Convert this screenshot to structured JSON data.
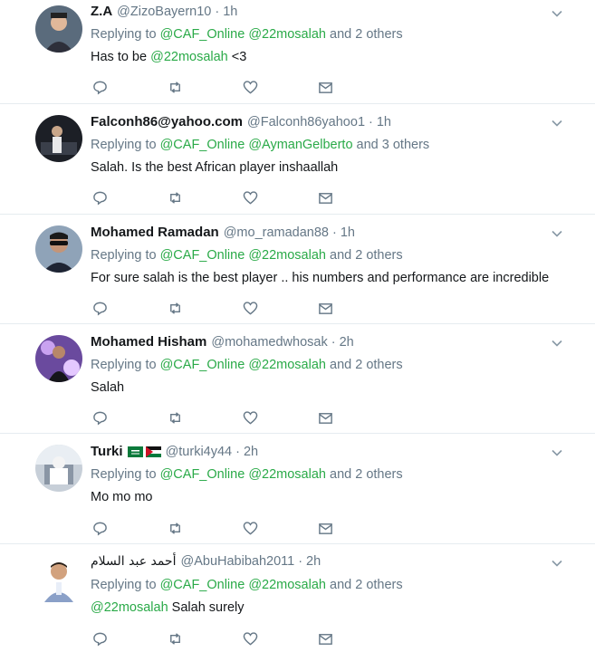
{
  "tweets": [
    {
      "name": "Z.A",
      "handle": "@ZizoBayern10",
      "time": "1h",
      "replying_to": "Replying to",
      "mention1": "@CAF_Online",
      "mention2": "@22mosalah",
      "others": "and 2 others",
      "text_prefix": "Has to be ",
      "text_mention": "@22mosalah",
      "text_suffix": " <3",
      "avatar_icon": "user-avatar"
    },
    {
      "name": "Falconh86@yahoo.com",
      "handle": "@Falconh86yahoo1",
      "time": "1h",
      "replying_to": "Replying to",
      "mention1": "@CAF_Online",
      "mention2": "@AymanGelberto",
      "others": "and 3 others",
      "text": "Salah. Is the best African player inshaallah",
      "avatar_icon": "user-avatar"
    },
    {
      "name": "Mohamed Ramadan",
      "handle": "@mo_ramadan88",
      "time": "1h",
      "replying_to": "Replying to",
      "mention1": "@CAF_Online",
      "mention2": "@22mosalah",
      "others": "and 2 others",
      "text": "For sure salah is the best player .. his numbers and performance are incredible",
      "avatar_icon": "user-avatar"
    },
    {
      "name": "Mohamed Hisham",
      "handle": "@mohamedwhosak",
      "time": "2h",
      "replying_to": "Replying to",
      "mention1": "@CAF_Online",
      "mention2": "@22mosalah",
      "others": "and 2 others",
      "text": "Salah",
      "avatar_icon": "user-avatar"
    },
    {
      "name": "Turki",
      "handle": "@turki4y44",
      "time": "2h",
      "replying_to": "Replying to",
      "mention1": "@CAF_Online",
      "mention2": "@22mosalah",
      "others": "and 2 others",
      "text": "Mo mo mo",
      "flags": [
        "saudi-flag-icon",
        "jordan-flag-icon"
      ],
      "avatar_icon": "user-avatar"
    },
    {
      "name": "أحمد عبد السلام",
      "handle": "@AbuHabibah2011",
      "time": "2h",
      "replying_to": "Replying to",
      "mention1": "@CAF_Online",
      "mention2": "@22mosalah",
      "others": "and 2 others",
      "text_mention": "@22mosalah",
      "text_suffix": " Salah surely",
      "avatar_icon": "user-avatar"
    }
  ],
  "separator": "·",
  "icons": [
    "reply-icon",
    "retweet-icon",
    "like-icon",
    "direct-message-icon",
    "chevron-down-icon"
  ],
  "colors": {
    "mention": "#2aaa48",
    "muted": "#657786",
    "text": "#14171a",
    "divider": "#e6ecf0"
  }
}
